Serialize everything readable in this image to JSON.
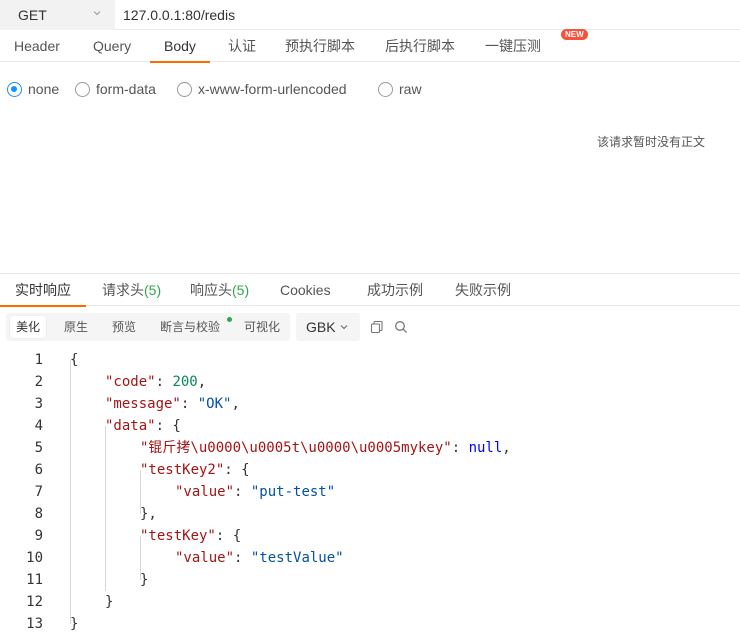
{
  "request": {
    "method": "GET",
    "url": "127.0.0.1:80/redis"
  },
  "request_tabs": [
    {
      "label": "Header"
    },
    {
      "label": "Query"
    },
    {
      "label": "Body"
    },
    {
      "label": "认证"
    },
    {
      "label": "预执行脚本"
    },
    {
      "label": "后执行脚本"
    },
    {
      "label": "一键压测"
    }
  ],
  "new_badge": "NEW",
  "body_types": [
    {
      "label": "none",
      "selected": true
    },
    {
      "label": "form-data",
      "selected": false
    },
    {
      "label": "x-www-form-urlencoded",
      "selected": false
    },
    {
      "label": "raw",
      "selected": false
    }
  ],
  "no_body_text": "该请求暂时没有正文",
  "response_tabs": [
    {
      "label": "实时响应"
    },
    {
      "label": "请求头",
      "count": "(5)"
    },
    {
      "label": "响应头",
      "count": "(5)"
    },
    {
      "label": "Cookies"
    },
    {
      "label": "成功示例"
    },
    {
      "label": "失败示例"
    }
  ],
  "view_modes": [
    {
      "label": "美化"
    },
    {
      "label": "原生"
    },
    {
      "label": "预览"
    },
    {
      "label": "断言与校验"
    },
    {
      "label": "可视化"
    }
  ],
  "encoding": "GBK",
  "icons": {
    "copy": "copy-icon",
    "search": "search-icon",
    "method_dropdown": "chevron-down-icon",
    "encoding_dropdown": "chevron-down-icon"
  },
  "colors": {
    "accent": "#ff6b00",
    "radio_selected": "#1890ff",
    "count_green": "#2fa84f",
    "json_key": "#a31515",
    "json_string": "#0451a5",
    "json_number": "#098658",
    "json_null": "#0000ff",
    "badge": "#f5533d"
  },
  "code_lines": [
    {
      "no": "1",
      "parts": [
        {
          "t": "{",
          "c": "p"
        }
      ]
    },
    {
      "no": "2",
      "parts": [
        {
          "t": "\"code\"",
          "c": "k"
        },
        {
          "t": ": ",
          "c": "p"
        },
        {
          "t": "200",
          "c": "n"
        },
        {
          "t": ",",
          "c": "p"
        }
      ]
    },
    {
      "no": "3",
      "parts": [
        {
          "t": "\"message\"",
          "c": "k"
        },
        {
          "t": ": ",
          "c": "p"
        },
        {
          "t": "\"OK\"",
          "c": "s"
        },
        {
          "t": ",",
          "c": "p"
        }
      ]
    },
    {
      "no": "4",
      "parts": [
        {
          "t": "\"data\"",
          "c": "k"
        },
        {
          "t": ": {",
          "c": "p"
        }
      ]
    },
    {
      "no": "5",
      "parts": [
        {
          "t": "\"锟斤拷\\u0000\\u0005t\\u0000\\u0005mykey\"",
          "c": "k"
        },
        {
          "t": ": ",
          "c": "p"
        },
        {
          "t": "null",
          "c": "kw"
        },
        {
          "t": ",",
          "c": "p"
        }
      ]
    },
    {
      "no": "6",
      "parts": [
        {
          "t": "\"testKey2\"",
          "c": "k"
        },
        {
          "t": ": {",
          "c": "p"
        }
      ]
    },
    {
      "no": "7",
      "parts": [
        {
          "t": "\"value\"",
          "c": "k"
        },
        {
          "t": ": ",
          "c": "p"
        },
        {
          "t": "\"put-test\"",
          "c": "s"
        }
      ]
    },
    {
      "no": "8",
      "parts": [
        {
          "t": "},",
          "c": "p"
        }
      ]
    },
    {
      "no": "9",
      "parts": [
        {
          "t": "\"testKey\"",
          "c": "k"
        },
        {
          "t": ": {",
          "c": "p"
        }
      ]
    },
    {
      "no": "10",
      "parts": [
        {
          "t": "\"value\"",
          "c": "k"
        },
        {
          "t": ": ",
          "c": "p"
        },
        {
          "t": "\"testValue\"",
          "c": "s"
        }
      ]
    },
    {
      "no": "11",
      "parts": [
        {
          "t": "}",
          "c": "p"
        }
      ]
    },
    {
      "no": "12",
      "parts": [
        {
          "t": "}",
          "c": "p"
        }
      ]
    },
    {
      "no": "13",
      "parts": [
        {
          "t": "}",
          "c": "p"
        }
      ]
    }
  ]
}
